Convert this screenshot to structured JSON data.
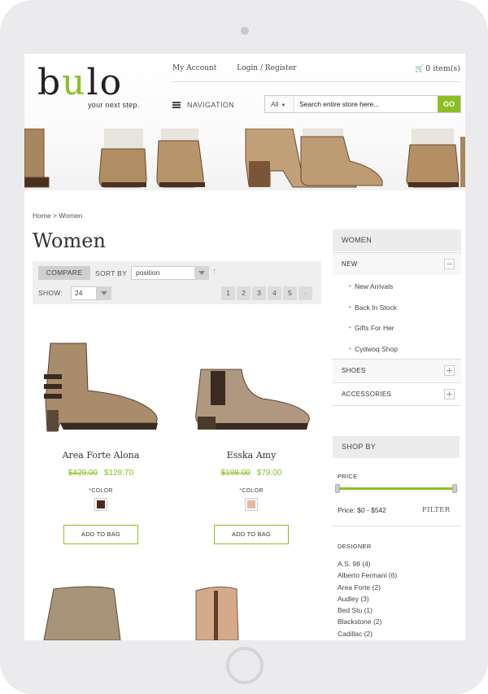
{
  "header": {
    "logo_prefix": "b",
    "logo_u": "u",
    "logo_suffix": "lo",
    "tagline": "your next step.",
    "my_account": "My Account",
    "login_register": "Login / Register",
    "cart": "0 item(s)",
    "navigation": "NAVIGATION",
    "search_category": "All",
    "search_placeholder": "Search entire store here...",
    "search_go": "GO"
  },
  "breadcrumb": "Home > Women",
  "page_title": "Women",
  "toolbar": {
    "compare": "COMPARE",
    "sort_by": "SORT BY",
    "sort_value": "position",
    "sort_arrow": "↑",
    "show": "SHOW:",
    "show_value": "24",
    "pages": [
      "1",
      "2",
      "3",
      "4",
      "5"
    ],
    "next": "›"
  },
  "products": [
    {
      "name": "Area Forte Alona",
      "old_price": "$429.00",
      "price": "$128.70",
      "color_label": "COLOR",
      "swatch": "#4a2a1e",
      "button": "ADD TO BAG"
    },
    {
      "name": "Esska Amy",
      "old_price": "$198.00",
      "price": "$79.00",
      "color_label": "COLOR",
      "swatch": "#e8b89e",
      "button": "ADD TO BAG"
    }
  ],
  "sidebar": {
    "women_head": "WOMEN",
    "new": "NEW",
    "new_items": [
      "New Arrivals",
      "Back In Stock",
      "Gifts For Her",
      "Cydwoq Shop"
    ],
    "shoes": "SHOES",
    "accessories": "ACCESSORIES",
    "shop_by": "SHOP BY",
    "price_label": "PRICE",
    "price_range": "Price: $0 - $542",
    "filter": "FILTER",
    "designer_label": "DESIGNER",
    "designers": [
      "A.S. 98 (4)",
      "Alberto Fermani (6)",
      "Area Forte (2)",
      "Audley (3)",
      "Bed Stu (1)",
      "Blackstone (2)",
      "Cadillac (2)"
    ]
  },
  "colors": {
    "accent": "#8cbf26",
    "shoe_tan": "#b0906a",
    "shoe_dark": "#6a4a30"
  }
}
